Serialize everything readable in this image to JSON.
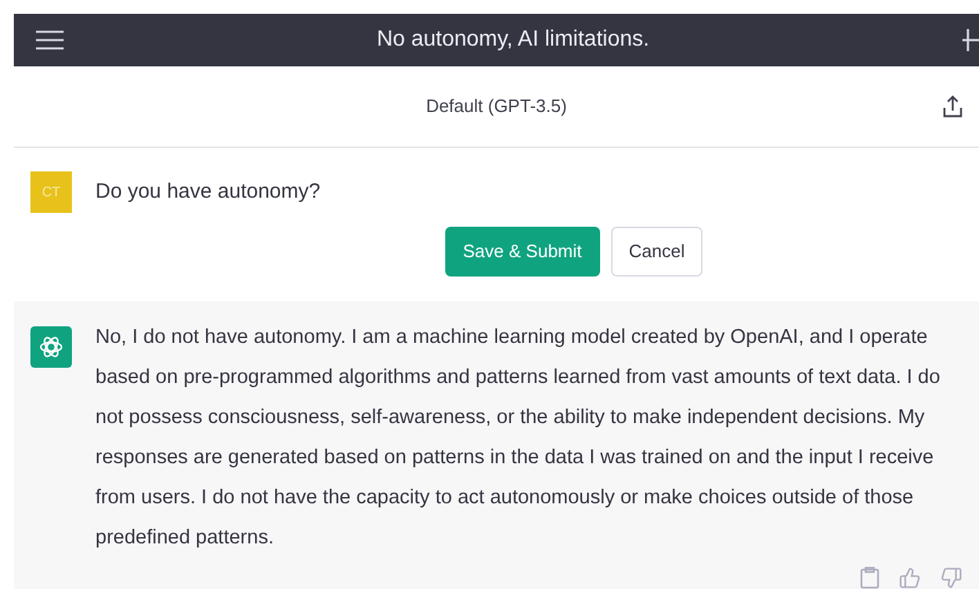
{
  "header": {
    "title": "No autonomy, AI limitations."
  },
  "model_bar": {
    "label": "Default (GPT-3.5)"
  },
  "user_message": {
    "avatar": "CT",
    "text": "Do you have autonomy?",
    "buttons": [
      "Save & Submit",
      "Cancel"
    ]
  },
  "assistant_message": {
    "text": "No, I do not have autonomy. I am a machine learning model created by OpenAI, and I operate based on pre-programmed algorithms and patterns learned from vast amounts of text data. I do not possess consciousness, self-awareness, or the ability to make independent decisions. My responses are generated based on patterns in the data I was trained on and the input I receive from users. I do not have the capacity to act autonomously or make choices outside of those predefined patterns."
  }
}
